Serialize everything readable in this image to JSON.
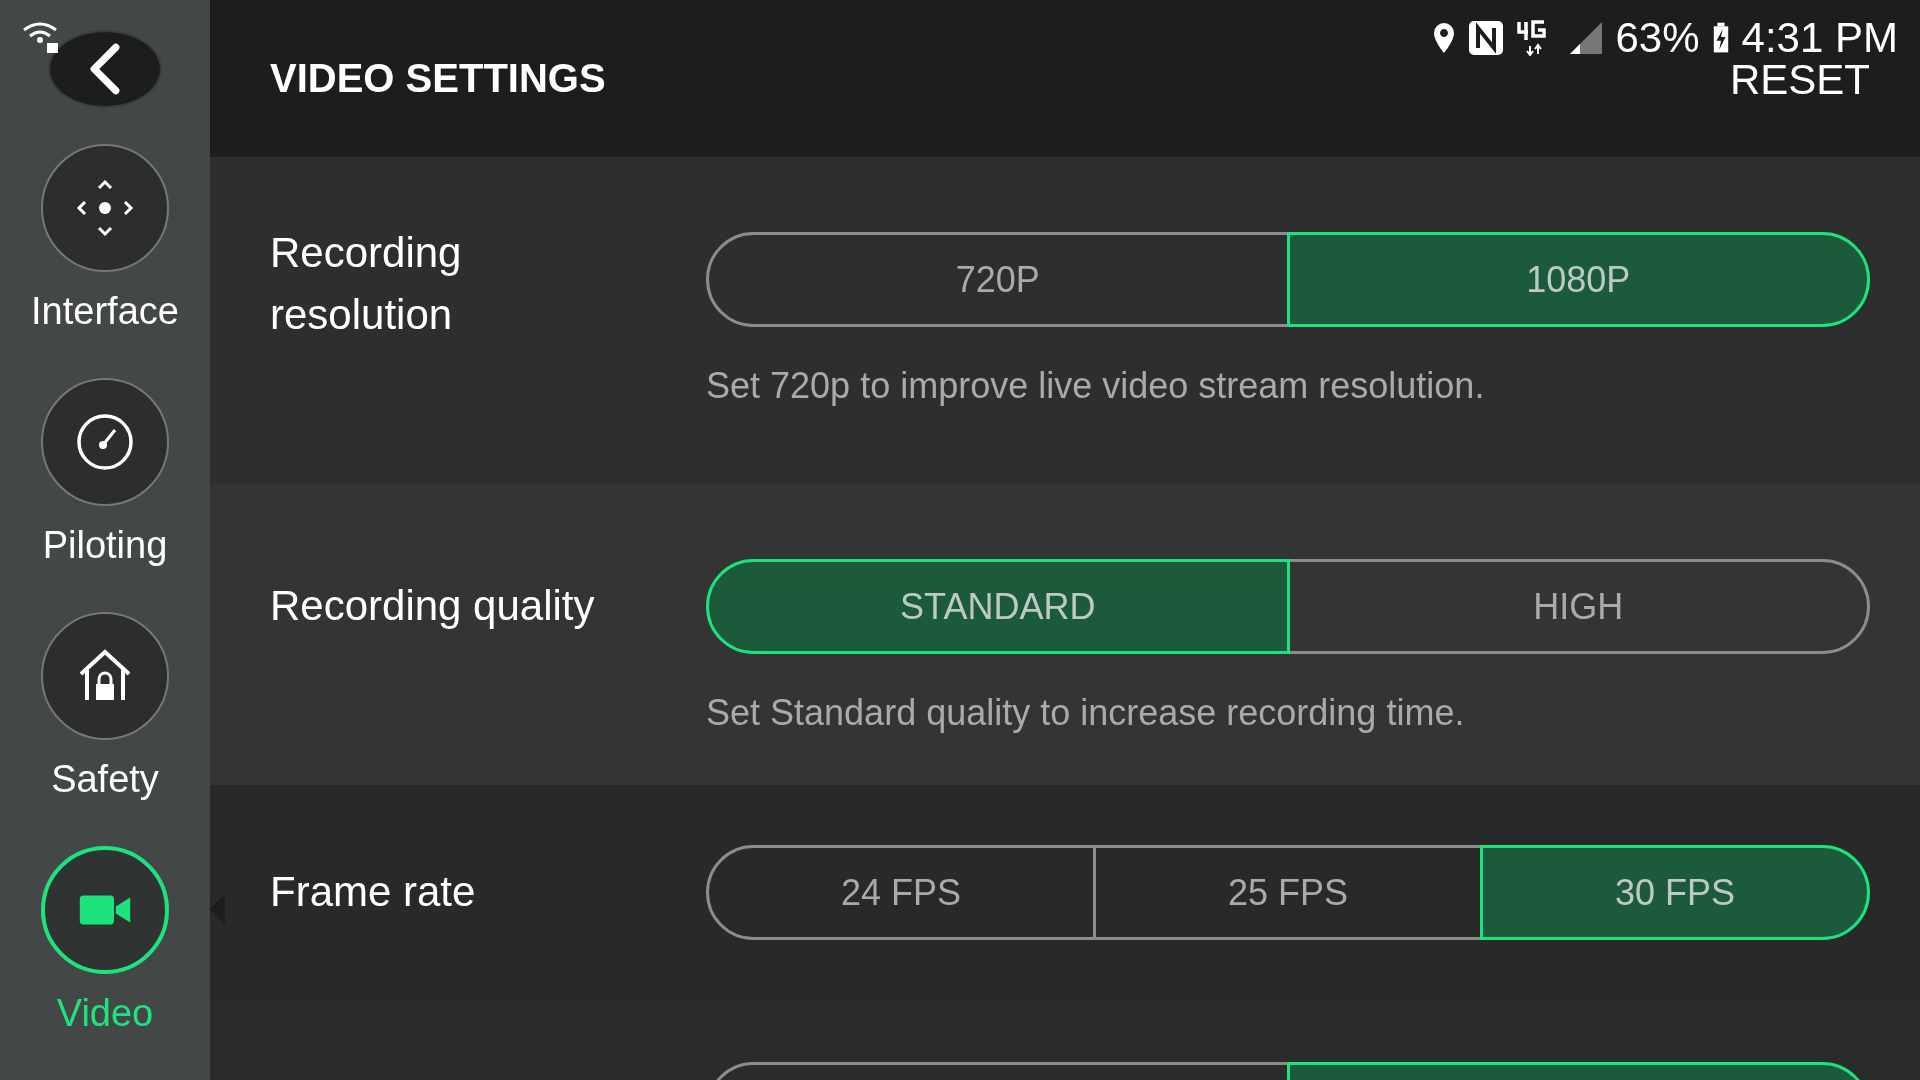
{
  "status_bar": {
    "battery": "63%",
    "time": "4:31 PM"
  },
  "sidebar": {
    "items": [
      {
        "kind": "interface",
        "label": "Interface",
        "selected": false
      },
      {
        "kind": "piloting",
        "label": "Piloting",
        "selected": false
      },
      {
        "kind": "safety",
        "label": "Safety",
        "selected": false
      },
      {
        "kind": "video",
        "label": "Video",
        "selected": true
      }
    ]
  },
  "header": {
    "title": "VIDEO SETTINGS",
    "reset": "RESET"
  },
  "settings": [
    {
      "label": "Recording resolution",
      "hint": "Set 720p to improve live video stream resolution.",
      "options": [
        {
          "label": "720P",
          "selected": false
        },
        {
          "label": "1080P",
          "selected": true
        }
      ]
    },
    {
      "label": "Recording quality",
      "hint": "Set Standard quality to increase recording time.",
      "options": [
        {
          "label": "STANDARD",
          "selected": true
        },
        {
          "label": "HIGH",
          "selected": false
        }
      ]
    },
    {
      "label": "Frame rate",
      "options": [
        {
          "label": "24 FPS",
          "selected": false
        },
        {
          "label": "25 FPS",
          "selected": false
        },
        {
          "label": "30 FPS",
          "selected": true
        }
      ]
    },
    {
      "options": [
        {
          "selected": false
        },
        {
          "selected": true
        }
      ]
    }
  ]
}
